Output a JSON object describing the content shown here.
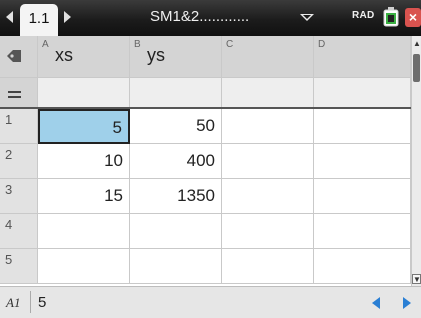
{
  "topbar": {
    "tab_label": "1.1",
    "document_title": "SM1&2............",
    "angle_mode": "RAD"
  },
  "sheet": {
    "column_headers": [
      {
        "letter": "A",
        "name": "xs"
      },
      {
        "letter": "B",
        "name": "ys"
      },
      {
        "letter": "C",
        "name": ""
      },
      {
        "letter": "D",
        "name": ""
      }
    ],
    "formula_row_symbol": "=",
    "rows": [
      {
        "num": "1",
        "cells": [
          "5",
          "50",
          "",
          ""
        ]
      },
      {
        "num": "2",
        "cells": [
          "10",
          "400",
          "",
          ""
        ]
      },
      {
        "num": "3",
        "cells": [
          "15",
          "1350",
          "",
          ""
        ]
      },
      {
        "num": "4",
        "cells": [
          "",
          "",
          "",
          ""
        ]
      },
      {
        "num": "5",
        "cells": [
          "",
          "",
          "",
          ""
        ]
      }
    ]
  },
  "statusbar": {
    "cell_ref": "A1",
    "cell_value": "5"
  },
  "colors": {
    "selection": "#9fd0ea",
    "header_bg": "#d4d4d4",
    "nav_arrow": "#2a7fd4",
    "close_button": "#d9534f"
  },
  "icons": [
    "tab-left-arrow-icon",
    "tab-right-arrow-icon",
    "dropdown-icon",
    "battery-icon",
    "close-icon",
    "corner-icon",
    "scroll-up-icon",
    "scroll-down-icon",
    "nav-left-icon",
    "nav-right-icon"
  ]
}
